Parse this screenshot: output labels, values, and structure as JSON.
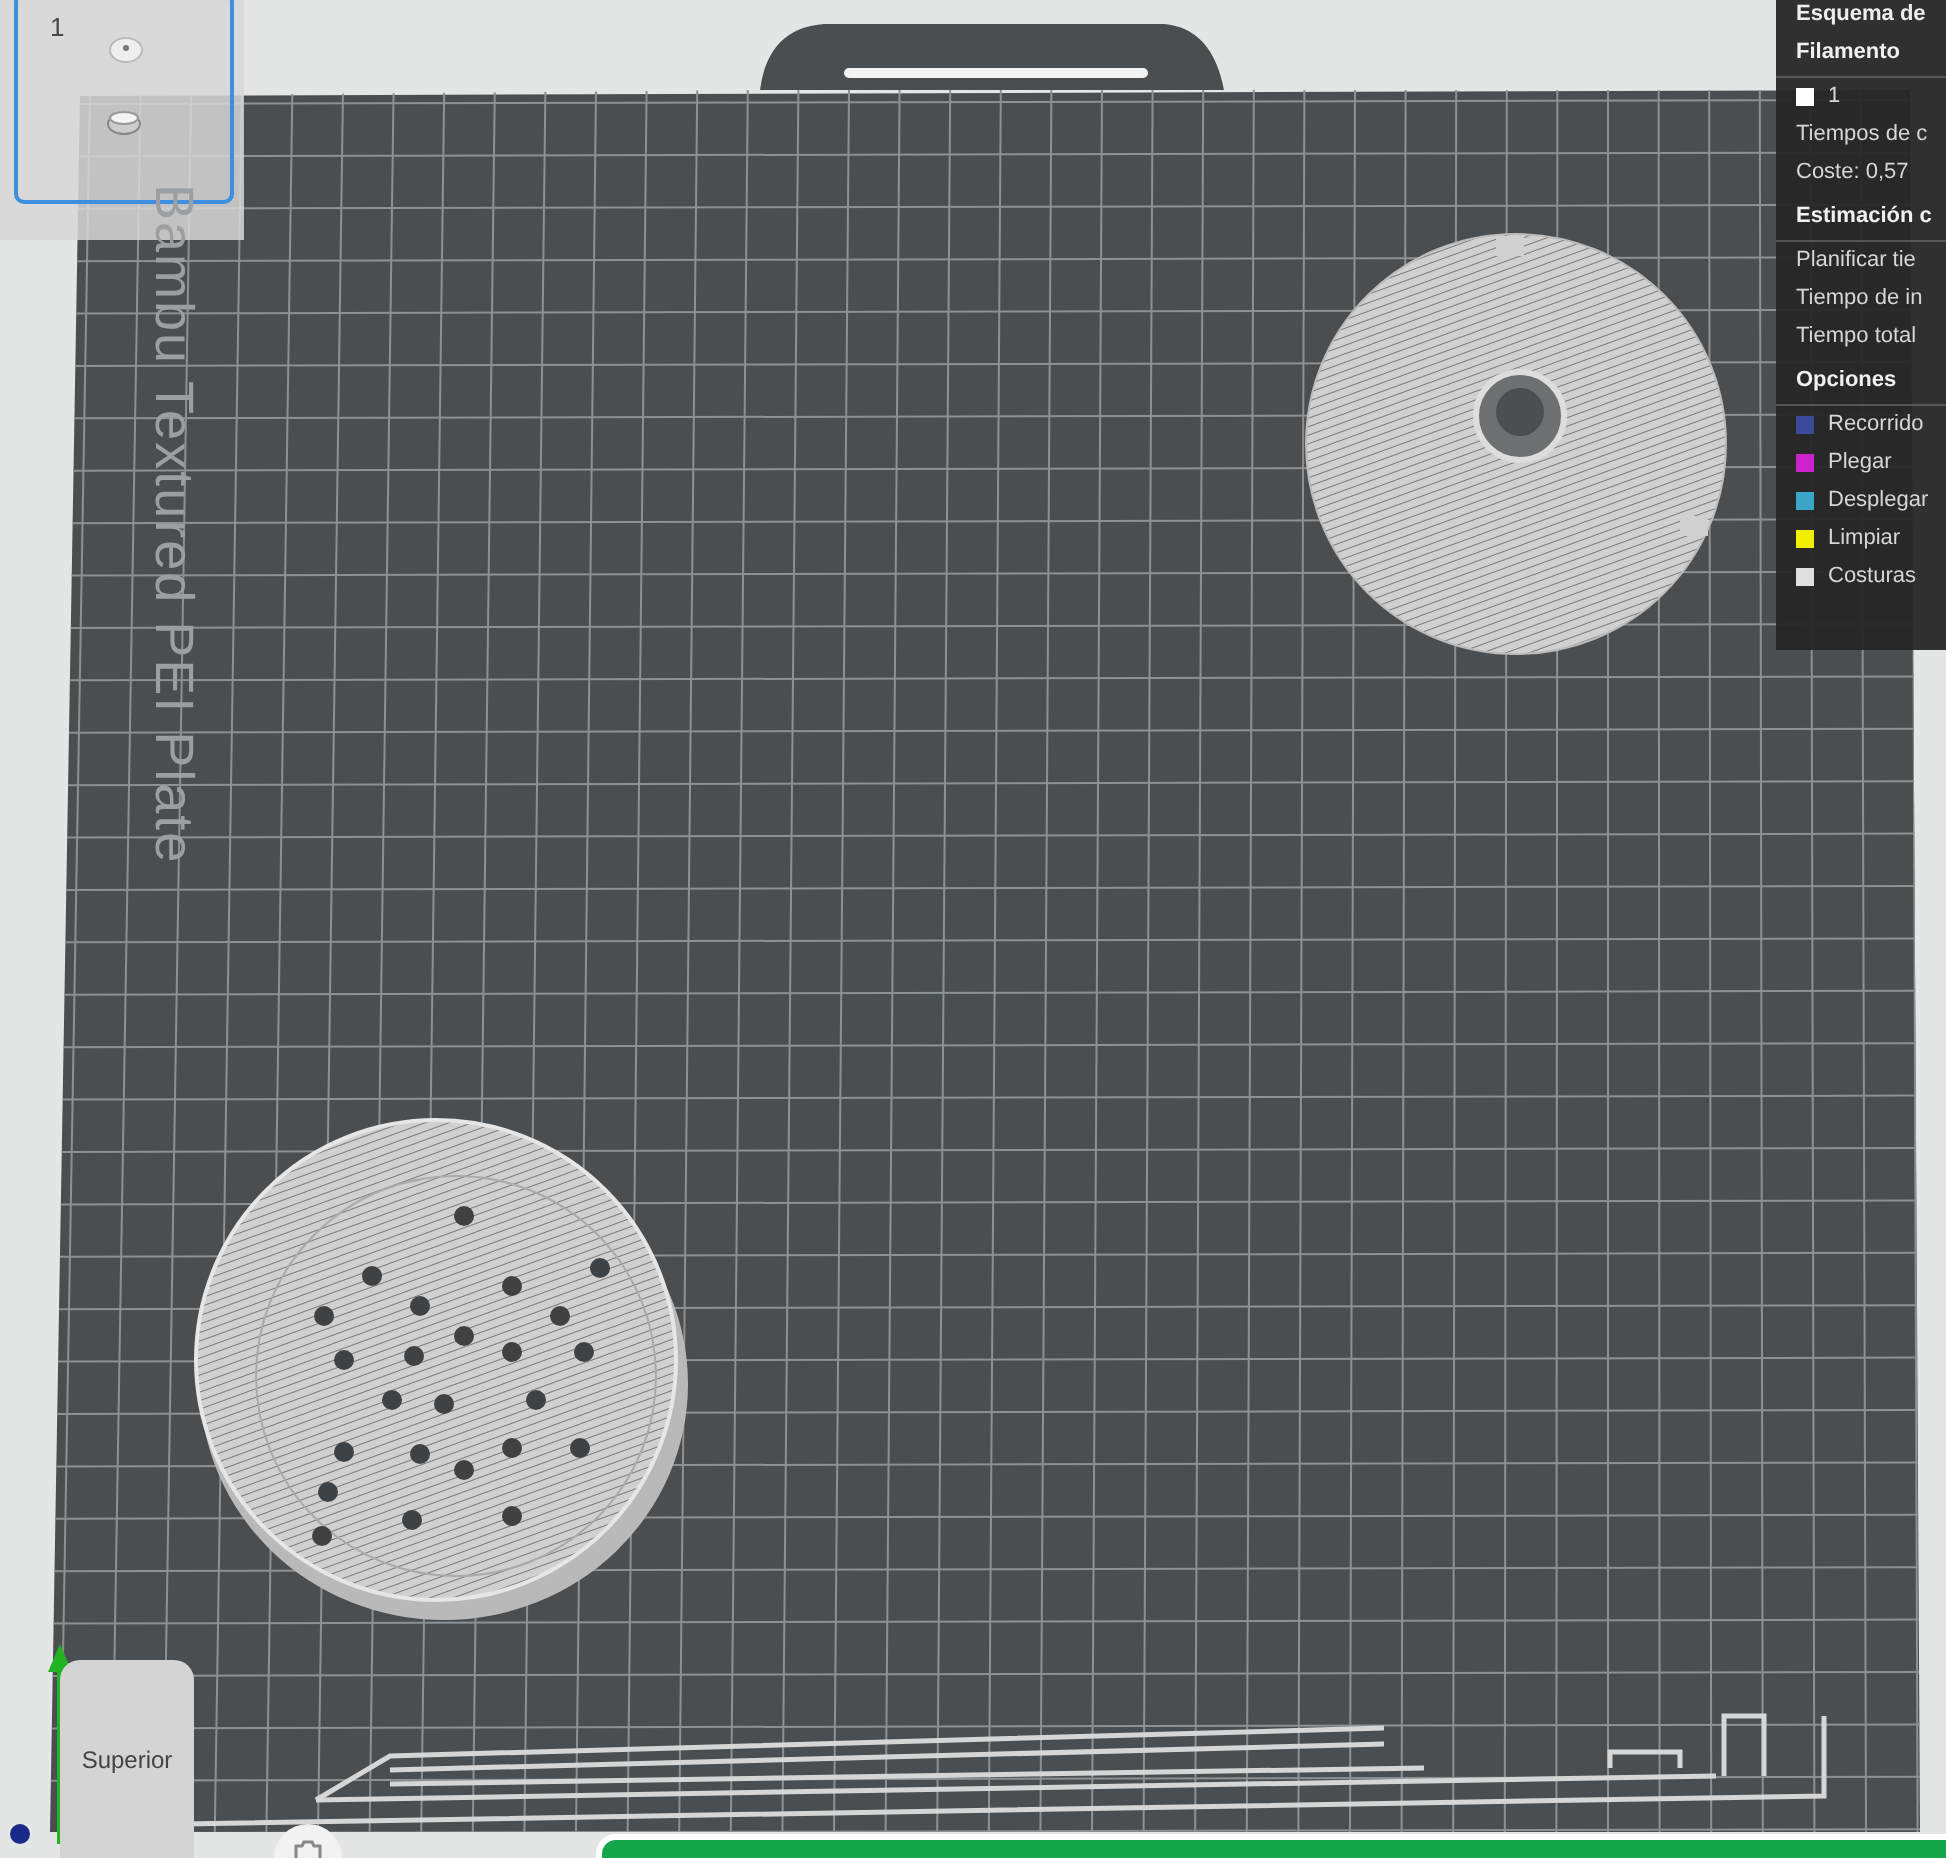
{
  "plate_thumbnails": [
    {
      "label": "1",
      "selected": true
    }
  ],
  "plate": {
    "name": "Bambu Textured PEI Plate"
  },
  "view_cube": {
    "label": "Superior"
  },
  "legend": {
    "title": "Esquema de",
    "sections": [
      {
        "heading": "Filamento",
        "kind": "filament",
        "swatch_label": "1",
        "lines": [
          "Tiempos de c",
          "Coste:  0,57"
        ]
      },
      {
        "heading": "Estimación c",
        "kind": "lines",
        "lines": [
          "Planificar tie",
          "Tiempo de in",
          "Tiempo total"
        ]
      },
      {
        "heading": "Opciones",
        "kind": "options",
        "items": [
          {
            "label": "Recorrido",
            "color": "#3b4a99"
          },
          {
            "label": "Plegar",
            "color": "#cc22cc"
          },
          {
            "label": "Desplegar",
            "color": "#3aa6c8"
          },
          {
            "label": "Limpiar",
            "color": "#f2ee00"
          },
          {
            "label": "Costuras",
            "color": "#e0e0e0"
          }
        ]
      }
    ]
  }
}
